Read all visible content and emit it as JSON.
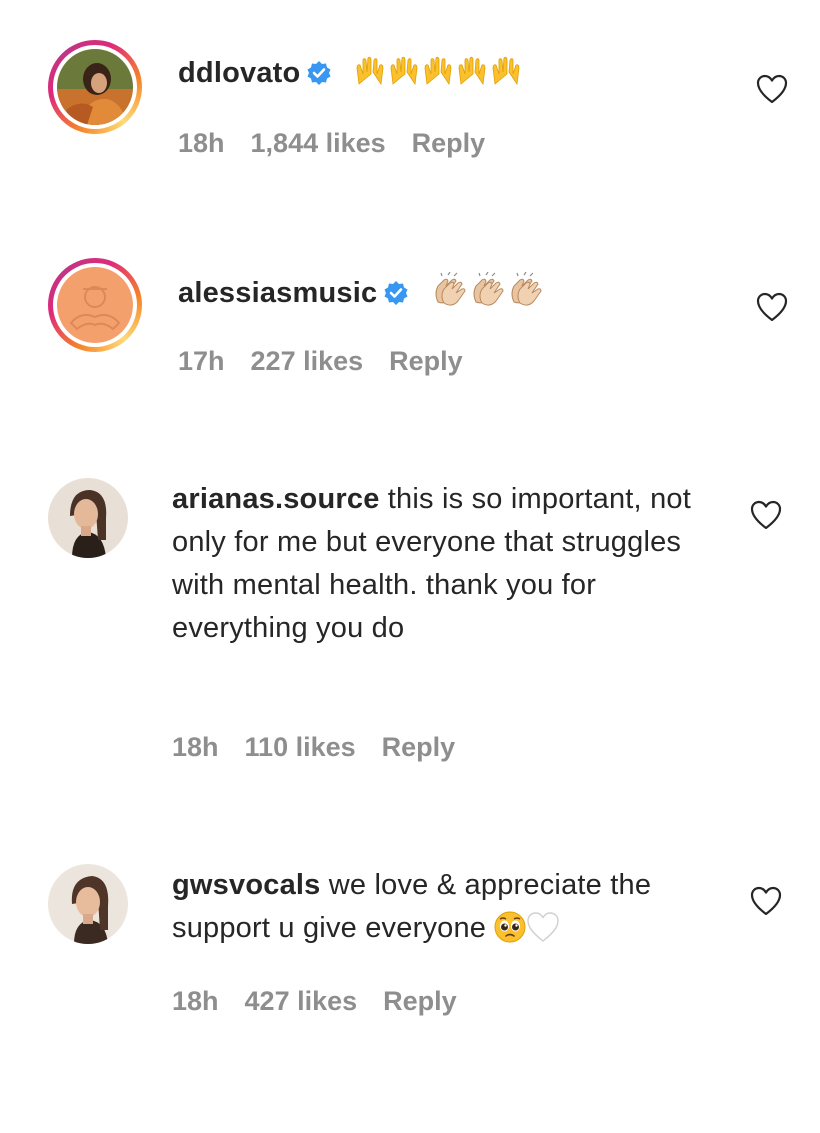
{
  "comments": [
    {
      "username": "ddlovato",
      "verified": true,
      "text": "",
      "emoji_icons": [
        "raising-hands-icon",
        "raising-hands-icon",
        "raising-hands-icon",
        "raising-hands-icon",
        "raising-hands-icon"
      ],
      "time": "18h",
      "likes": "1,844 likes",
      "reply": "Reply",
      "has_story_ring": true
    },
    {
      "username": "alessiasmusic",
      "verified": true,
      "text": "",
      "emoji_icons": [
        "clapping-hands-icon",
        "clapping-hands-icon",
        "clapping-hands-icon"
      ],
      "time": "17h",
      "likes": "227 likes",
      "reply": "Reply",
      "has_story_ring": true
    },
    {
      "username": "arianas.source",
      "verified": false,
      "text": "this is so important, not only for me but everyone that struggles with mental health. thank you for everything you do",
      "emoji_icons": [],
      "time": "18h",
      "likes": "110 likes",
      "reply": "Reply",
      "has_story_ring": false
    },
    {
      "username": "gwsvocals",
      "verified": false,
      "text": "we love & appreciate the support u give everyone",
      "emoji_icons": [
        "pleading-face-icon",
        "white-heart-icon"
      ],
      "time": "18h",
      "likes": "427 likes",
      "reply": "Reply",
      "has_story_ring": false
    }
  ],
  "colors": {
    "text": "#262626",
    "meta": "#8e8e8e",
    "verified": "#3897f0",
    "emoji_yellow": "#fbc02d",
    "clap_skin": "#e8c4a0"
  }
}
